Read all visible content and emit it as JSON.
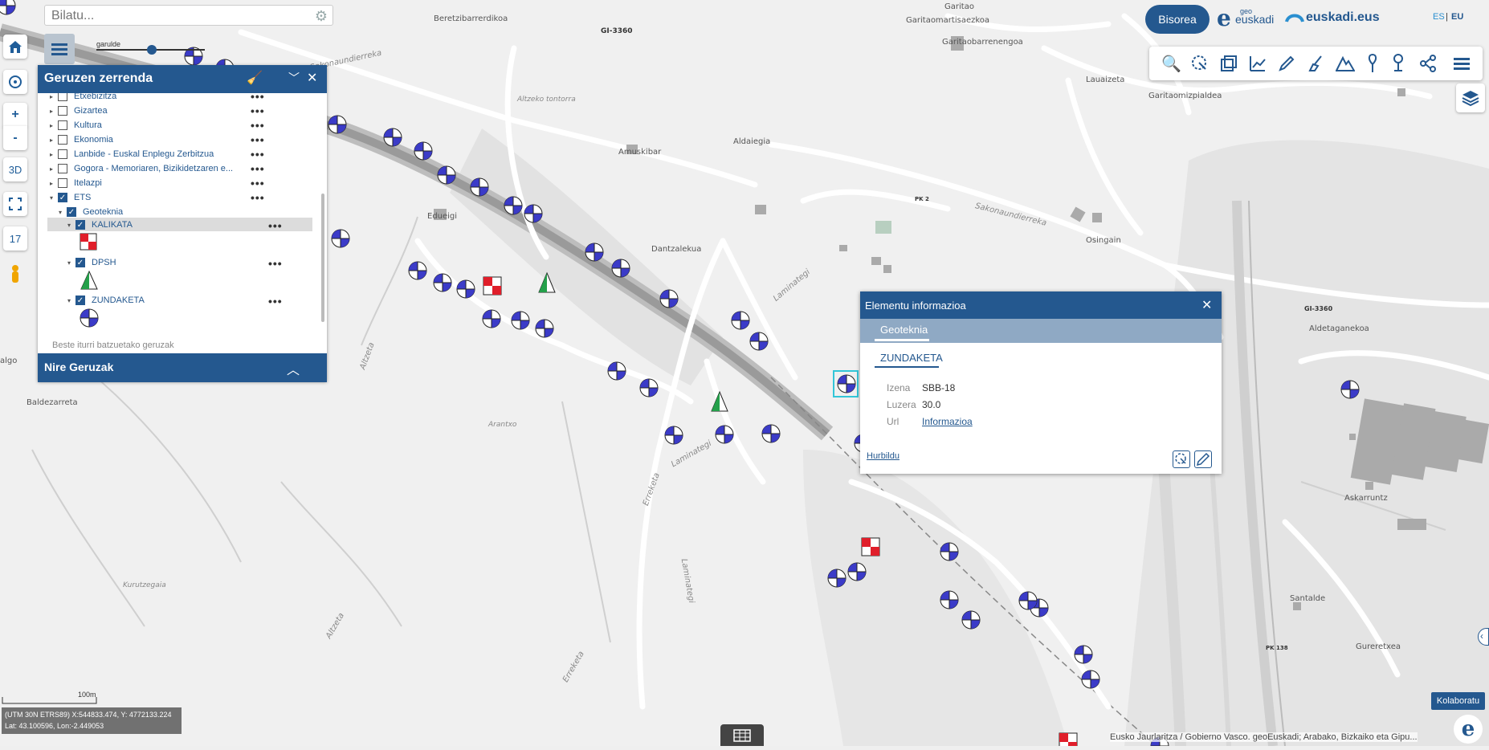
{
  "search": {
    "placeholder": "Bilatu..."
  },
  "left_toolbar": {
    "three_d_label": "3D",
    "zoom_label": "17",
    "zoom_in_label": "+",
    "zoom_out_label": "-"
  },
  "slider": {
    "label": "garulde"
  },
  "layer_panel": {
    "title": "Geruzen zerrenda",
    "items": [
      {
        "label": "Etxebizitza"
      },
      {
        "label": "Gizartea"
      },
      {
        "label": "Kultura"
      },
      {
        "label": "Ekonomia"
      },
      {
        "label": "Lanbide - Euskal Enplegu Zerbitzua"
      },
      {
        "label": "Gogora - Memoriaren, Bizikidetzaren e..."
      },
      {
        "label": "Itelazpi"
      },
      {
        "label": "ETS"
      },
      {
        "label": "Geoteknia"
      },
      {
        "label": "KALIKATA"
      },
      {
        "label": "DPSH"
      },
      {
        "label": "ZUNDAKETA"
      }
    ],
    "external_label": "Beste iturri batzuetako geruzak",
    "nire_label": "Nire Geruzak"
  },
  "top_right": {
    "bisorea_label": "Bisorea",
    "geo_small": "geo",
    "geoeuskadi_label": "euskadi",
    "euskadi_eus_label": "euskadi.eus",
    "lang_es": "ES",
    "lang_sep": "|",
    "lang_eu": "EU"
  },
  "popup": {
    "title": "Elementu informazioa",
    "tab": "Geoteknia",
    "subtab": "ZUNDAKETA",
    "fields": [
      {
        "key": "Izena",
        "value": "SBB-18"
      },
      {
        "key": "Luzera",
        "value": "30.0"
      },
      {
        "key": "Url",
        "value": "Informazioa"
      }
    ],
    "zoom_link": "Hurbildu"
  },
  "map_labels": [
    {
      "text": "Beretzibarrerdikoa"
    },
    {
      "text": "GI-3360"
    },
    {
      "text": "Garitao"
    },
    {
      "text": "Garitaomartisaezkoa"
    },
    {
      "text": "Garitaobarrenengoa"
    },
    {
      "text": "Sakonaundierreka"
    },
    {
      "text": "Lauaizeta"
    },
    {
      "text": "Garitaomizpialdea"
    },
    {
      "text": "Altzeko tontorra"
    },
    {
      "text": "Amuskibar"
    },
    {
      "text": "Aldaiegia"
    },
    {
      "text": "PK 2"
    },
    {
      "text": "Sakonaundierreka"
    },
    {
      "text": "Osingain"
    },
    {
      "text": "Edueigi"
    },
    {
      "text": "Dantzalekua"
    },
    {
      "text": "Laminategi"
    },
    {
      "text": "Altzeta"
    },
    {
      "text": "Arantxo"
    },
    {
      "text": "Baldezarreta"
    },
    {
      "text": "algo"
    },
    {
      "text": "Laminategi"
    },
    {
      "text": "Erreketa"
    },
    {
      "text": "Laminategi"
    },
    {
      "text": "Kurutzegaia"
    },
    {
      "text": "Altzeta"
    },
    {
      "text": "Erreketa"
    },
    {
      "text": "GI-3360"
    },
    {
      "text": "Aldetaganekoa"
    },
    {
      "text": "Askarruntz"
    },
    {
      "text": "Santalde"
    },
    {
      "text": "PK 138"
    },
    {
      "text": "Gureretxea"
    }
  ],
  "scale_label": "100m",
  "coords": {
    "line1": "(UTM 30N ETRS89) X:544833.474, Y: 4772133.224",
    "line2": "Lat: 43.100596, Lon:-2.449053"
  },
  "attribution": "Eusko Jaurlaritza / Gobierno Vasco. geoEuskadi; Arabako, Bizkaiko eta Gipu...",
  "kolaboratu_label": "Kolaboratu"
}
